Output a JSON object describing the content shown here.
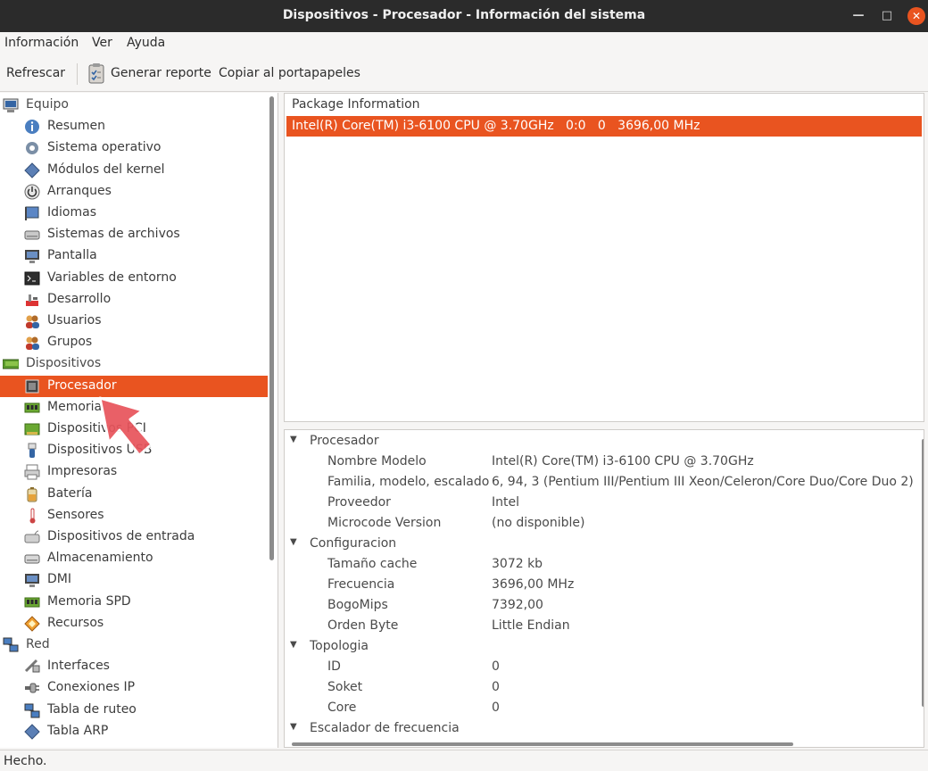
{
  "window": {
    "title": "Dispositivos - Procesador - Información del sistema"
  },
  "menu": [
    "Información",
    "Ver",
    "Ayuda"
  ],
  "toolbar": {
    "refresh": "Refrescar",
    "report": "Generar reporte",
    "copy": "Copiar al portapapeles"
  },
  "sidebar": {
    "rows": [
      {
        "label": "Equipo",
        "type": "cat",
        "icon": "computer-icon"
      },
      {
        "label": "Resumen",
        "type": "item",
        "icon": "info-icon"
      },
      {
        "label": "Sistema operativo",
        "type": "item",
        "icon": "gear-icon"
      },
      {
        "label": "Módulos del kernel",
        "type": "item",
        "icon": "diamond-icon"
      },
      {
        "label": "Arranques",
        "type": "item",
        "icon": "power-icon"
      },
      {
        "label": "Idiomas",
        "type": "item",
        "icon": "flag-icon"
      },
      {
        "label": "Sistemas de archivos",
        "type": "item",
        "icon": "drive-icon"
      },
      {
        "label": "Pantalla",
        "type": "item",
        "icon": "monitor-icon"
      },
      {
        "label": "Variables de entorno",
        "type": "item",
        "icon": "terminal-icon"
      },
      {
        "label": "Desarrollo",
        "type": "item",
        "icon": "tools-icon"
      },
      {
        "label": "Usuarios",
        "type": "item",
        "icon": "users-icon"
      },
      {
        "label": "Grupos",
        "type": "item",
        "icon": "group-icon"
      },
      {
        "label": "Dispositivos",
        "type": "cat",
        "icon": "board-icon"
      },
      {
        "label": "Procesador",
        "type": "item",
        "icon": "cpu-icon",
        "selected": true
      },
      {
        "label": "Memoria",
        "type": "item",
        "icon": "memory-icon"
      },
      {
        "label": "Dispositivos PCI",
        "type": "item",
        "icon": "pci-icon"
      },
      {
        "label": "Dispositivos USB",
        "type": "item",
        "icon": "usb-icon"
      },
      {
        "label": "Impresoras",
        "type": "item",
        "icon": "printer-icon"
      },
      {
        "label": "Batería",
        "type": "item",
        "icon": "battery-icon"
      },
      {
        "label": "Sensores",
        "type": "item",
        "icon": "thermometer-icon"
      },
      {
        "label": "Dispositivos de entrada",
        "type": "item",
        "icon": "keyboard-icon"
      },
      {
        "label": "Almacenamiento",
        "type": "item",
        "icon": "storage-icon"
      },
      {
        "label": "DMI",
        "type": "item",
        "icon": "dmi-icon"
      },
      {
        "label": "Memoria SPD",
        "type": "item",
        "icon": "spd-icon"
      },
      {
        "label": "Recursos",
        "type": "item",
        "icon": "resources-icon"
      },
      {
        "label": "Red",
        "type": "cat",
        "icon": "network-icon"
      },
      {
        "label": "Interfaces",
        "type": "item",
        "icon": "interfaces-icon"
      },
      {
        "label": "Conexiones IP",
        "type": "item",
        "icon": "plug-icon"
      },
      {
        "label": "Tabla de ruteo",
        "type": "item",
        "icon": "routing-icon"
      },
      {
        "label": "Tabla ARP",
        "type": "item",
        "icon": "arp-icon"
      }
    ]
  },
  "package": {
    "header": "Package Information",
    "row": "Intel(R) Core(TM) i3-6100 CPU @ 3.70GHz   0:0   0   3696,00 MHz"
  },
  "details": {
    "sections": [
      {
        "title": "Procesador",
        "rows": [
          [
            "Nombre Modelo",
            "Intel(R) Core(TM) i3-6100 CPU @ 3.70GHz"
          ],
          [
            "Familia, modelo, escalado",
            "6, 94, 3 (Pentium III/Pentium III Xeon/Celeron/Core Duo/Core Duo 2)"
          ],
          [
            "Proveedor",
            "Intel"
          ],
          [
            "Microcode Version",
            "(no disponible)"
          ]
        ]
      },
      {
        "title": "Configuracion",
        "rows": [
          [
            "Tamaño cache",
            "3072 kb"
          ],
          [
            "Frecuencia",
            "3696,00 MHz"
          ],
          [
            "BogoMips",
            "7392,00"
          ],
          [
            "Orden Byte",
            "Little Endian"
          ]
        ]
      },
      {
        "title": "Topologia",
        "rows": [
          [
            "ID",
            "0"
          ],
          [
            "Soket",
            "0"
          ],
          [
            "Core",
            "0"
          ]
        ]
      },
      {
        "title": "Escalador de frecuencia",
        "rows": []
      }
    ]
  },
  "status": "Hecho.",
  "colors": {
    "accent": "#e95420",
    "titlebar": "#2b2b2b"
  }
}
